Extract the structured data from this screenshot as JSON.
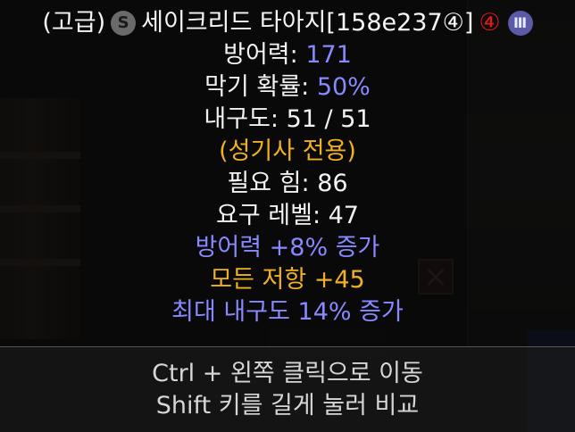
{
  "tooltip": {
    "grade": "(고급)",
    "set_badge": "S",
    "item_name": "세이크리드 타아지[158e237④]",
    "socket_badge": "④",
    "tier_badge": "Ⅲ",
    "defense_label": "방어력:",
    "defense_value": "171",
    "block_label": "막기 확률:",
    "block_value": "50%",
    "durability": "내구도: 51 / 51",
    "class_only": "(성기사 전용)",
    "req_str": "필요 힘: 86",
    "req_level": "요구 레벨: 47",
    "mod_defense": "방어력 +8% 증가",
    "mod_resist": "모든 저항 +45",
    "mod_durability": "최대 내구도 14% 증가"
  },
  "hints": {
    "move": "Ctrl + 왼쪽 클릭으로 이동",
    "compare": "Shift 키를 길게 눌러 비교"
  },
  "colors": {
    "magic_blue": "#8888ff",
    "gold": "#f0b020",
    "red_badge": "#e01818",
    "white": "#f2f2f2"
  },
  "icons": {
    "set_badge": "s-circle-icon",
    "tier_badge": "tier-three-icon"
  }
}
